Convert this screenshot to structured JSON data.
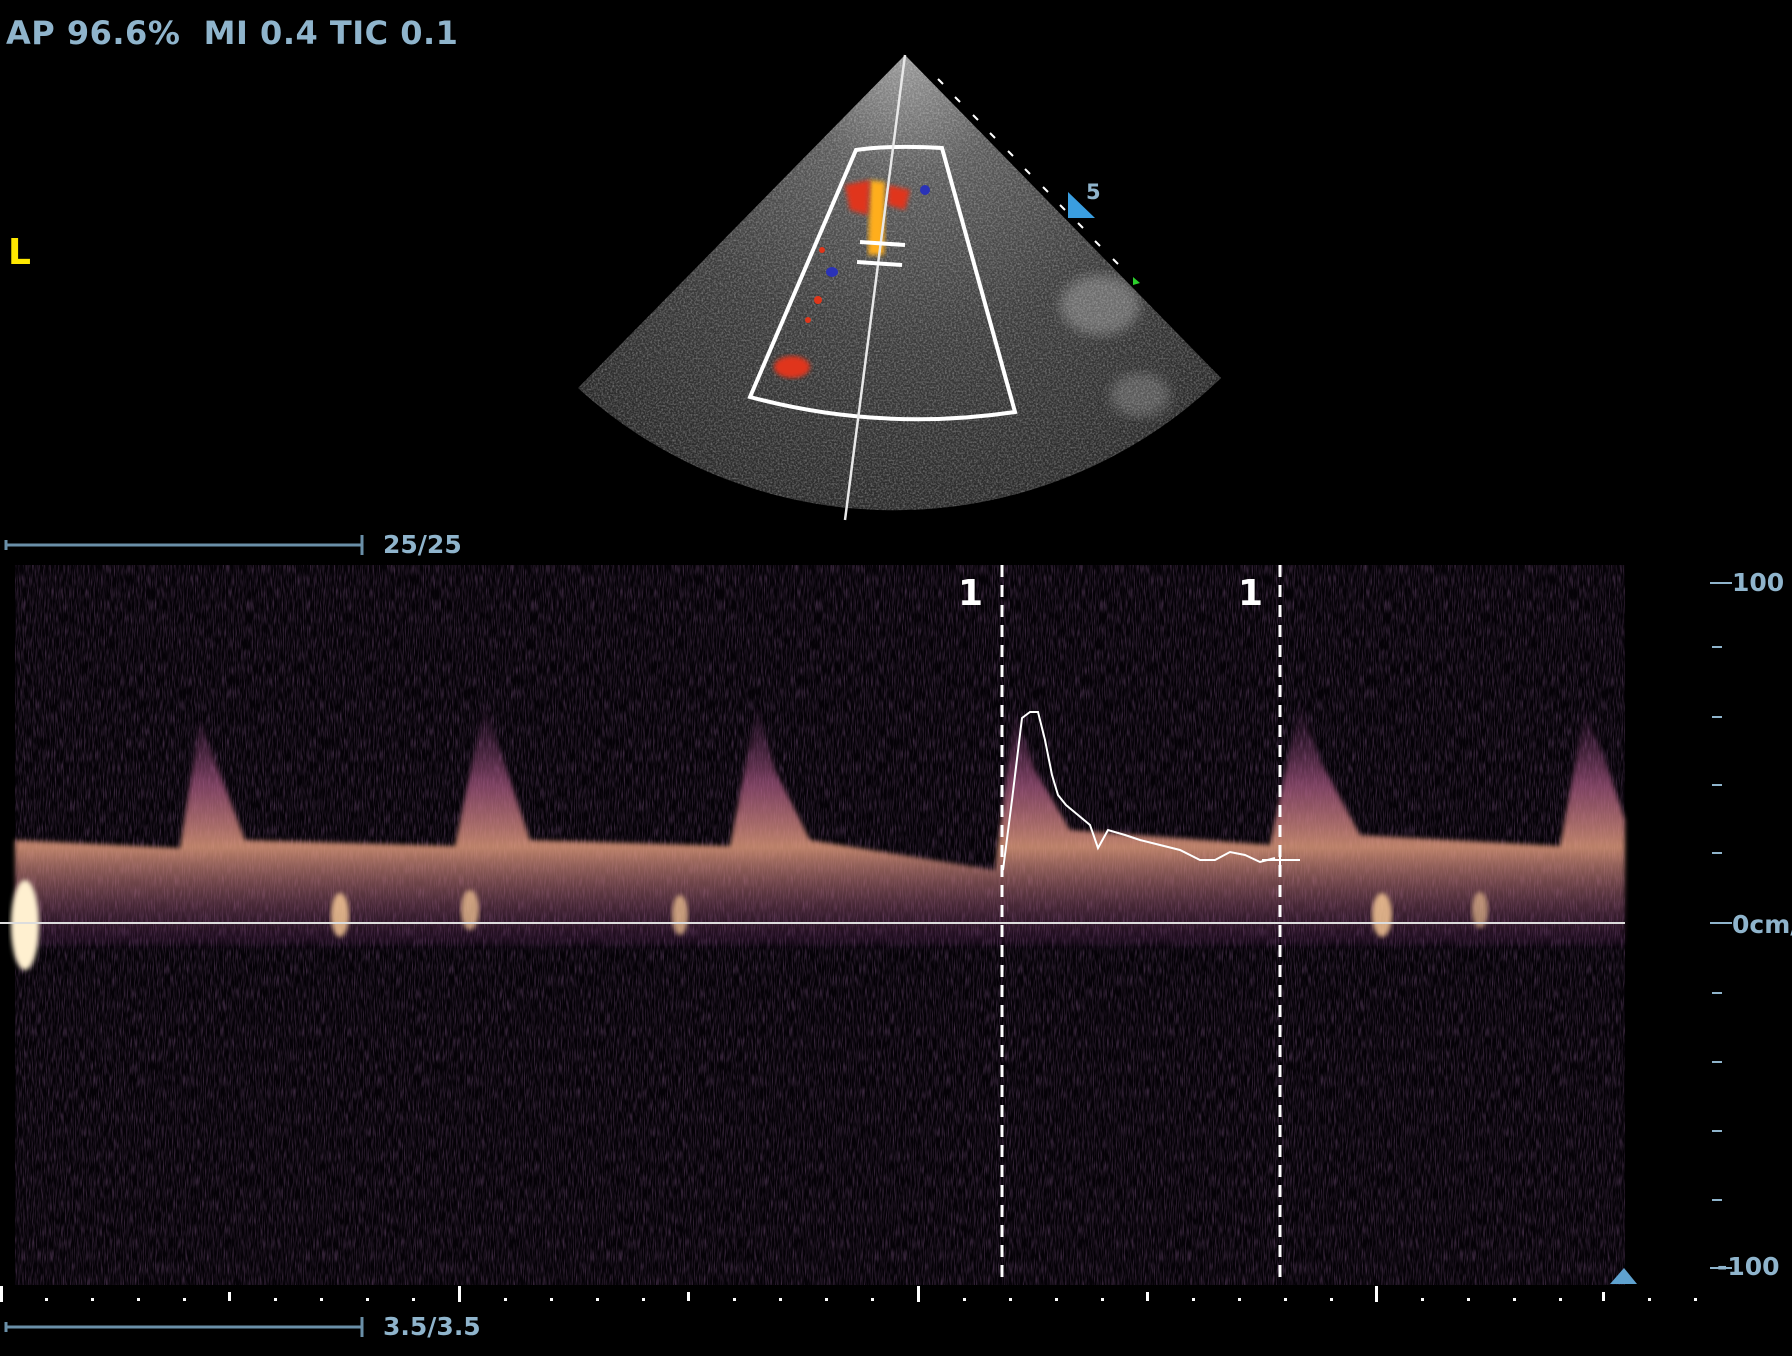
{
  "header": {
    "params_text": "AP 96.6%  MI 0.4 TIC 0.1"
  },
  "orientation_marker": "L",
  "focus_depth_label": "5",
  "scales": {
    "top_label": "25/25",
    "bottom_label": "3.5/3.5"
  },
  "velocity_axis": {
    "top_label": "100",
    "zero_label": "0cm/",
    "bottom_label": "-100"
  },
  "calipers": [
    {
      "label": "1"
    },
    {
      "label": "1"
    }
  ],
  "colors": {
    "label_blue": "#8fb4cc",
    "orientation_yellow": "#ffe800",
    "doppler_red": "#e0361a",
    "doppler_orange": "#ffae1e",
    "doppler_blue": "#2a32b8",
    "spectrum_purple": "#5a2a64"
  }
}
